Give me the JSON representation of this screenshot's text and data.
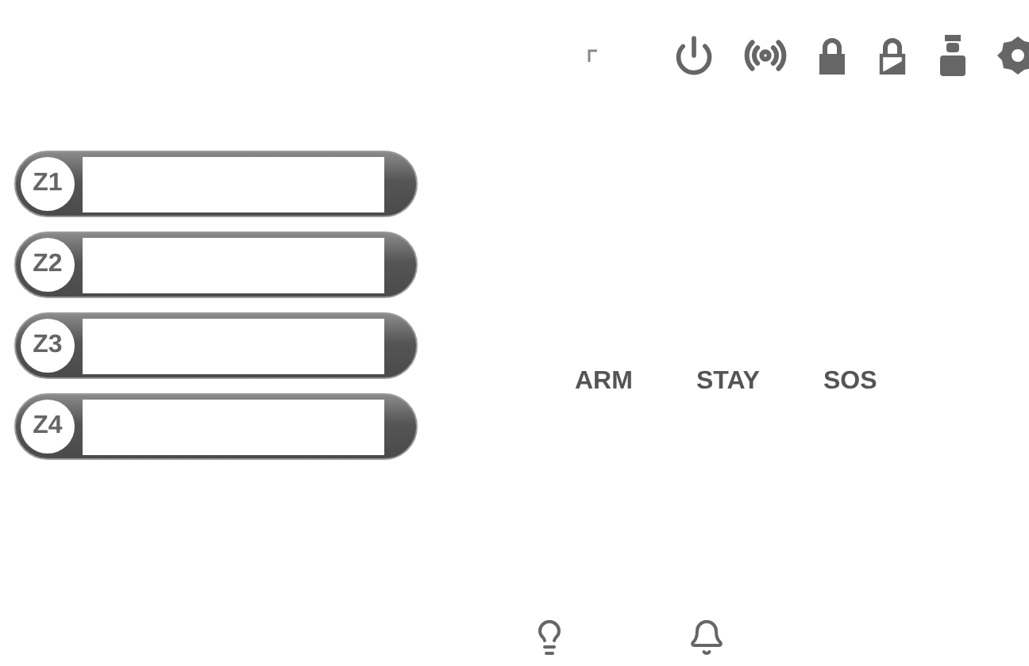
{
  "zones": [
    {
      "label": "Z1"
    },
    {
      "label": "Z2"
    },
    {
      "label": "Z3"
    },
    {
      "label": "Z4"
    }
  ],
  "actions": [
    "ARM",
    "STAY",
    "SOS"
  ]
}
